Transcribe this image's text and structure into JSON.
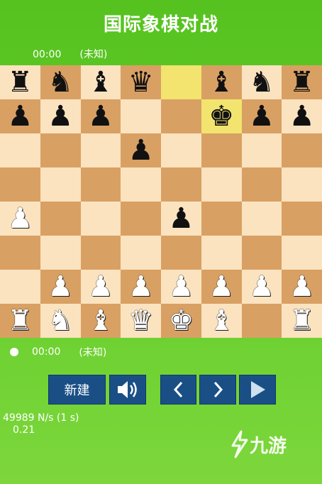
{
  "title": "国际象棋对战",
  "top_player": {
    "time": "00:00",
    "status": "(未知)"
  },
  "bottom_player": {
    "time": "00:00",
    "status": "(未知)"
  },
  "highlighted_squares": [
    "e8",
    "f7"
  ],
  "board": [
    [
      "r",
      "n",
      "b",
      "q",
      "",
      "b",
      "n",
      "r"
    ],
    [
      "p",
      "p",
      "p",
      "",
      "",
      "k",
      "p",
      "p"
    ],
    [
      "",
      "",
      "",
      "p",
      "",
      "",
      "",
      ""
    ],
    [
      "",
      "",
      "",
      "",
      "",
      "",
      "",
      ""
    ],
    [
      "P",
      "",
      "",
      "",
      "p",
      "",
      "",
      ""
    ],
    [
      "",
      "",
      "",
      "",
      "",
      "",
      "",
      ""
    ],
    [
      "",
      "P",
      "P",
      "P",
      "P",
      "P",
      "P",
      "P"
    ],
    [
      "R",
      "N",
      "B",
      "Q",
      "K",
      "B",
      "",
      "R"
    ]
  ],
  "buttons": {
    "new_label": "新建",
    "sound_icon": "speaker-icon",
    "prev_icon": "chevron-left-icon",
    "next_icon": "chevron-right-icon",
    "play_icon": "play-icon"
  },
  "stats": {
    "speed": "49989 N/s (1 s)",
    "time": "0.21"
  },
  "watermark": "九游",
  "colors": {
    "background": "#5cc425",
    "light_square": "#fbe3bf",
    "dark_square": "#d9a063",
    "highlight": "#f2e46e",
    "button": "#1a4f86"
  }
}
